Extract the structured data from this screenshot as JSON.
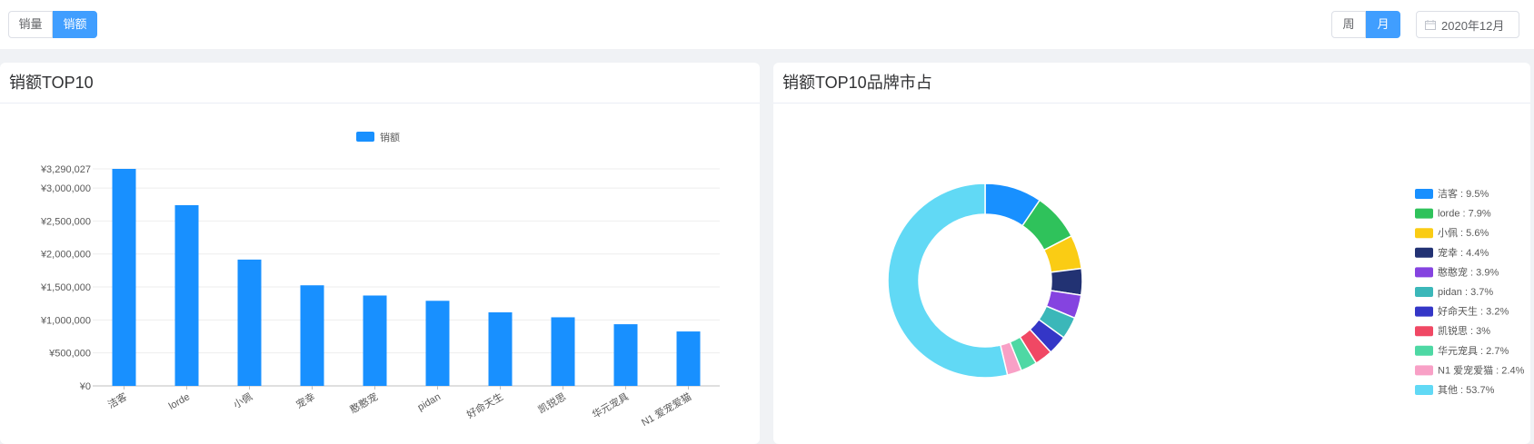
{
  "toolbar": {
    "metric_tabs": [
      {
        "label": "销量",
        "active": false
      },
      {
        "label": "销额",
        "active": true
      }
    ],
    "period_tabs": [
      {
        "label": "周",
        "active": false
      },
      {
        "label": "月",
        "active": true
      }
    ],
    "date_value": "2020年12月",
    "date_icon": "calendar-icon",
    "accent_color": "#409eff"
  },
  "bar_panel": {
    "title": "销额TOP10"
  },
  "pie_panel": {
    "title": "销额TOP10品牌市占"
  },
  "chart_data": [
    {
      "type": "bar",
      "title": "",
      "legend": [
        "销额"
      ],
      "legend_position": "top",
      "color": "#1890ff",
      "categories": [
        "洁客",
        "lorde",
        "小佩",
        "宠幸",
        "憨憨宠",
        "pidan",
        "好命天生",
        "凯锐思",
        "华元宠具",
        "N1 爱宠爱猫"
      ],
      "values": [
        3290027,
        2740000,
        1915000,
        1525000,
        1370000,
        1290000,
        1115000,
        1040000,
        935000,
        825000
      ],
      "y_ticks": [
        "¥0",
        "¥500,000",
        "¥1,000,000",
        "¥1,500,000",
        "¥2,000,000",
        "¥2,500,000",
        "¥3,000,000",
        "¥3,290,027"
      ],
      "y_tick_values": [
        0,
        500000,
        1000000,
        1500000,
        2000000,
        2500000,
        3000000,
        3290027
      ],
      "ylim": [
        0,
        3290027
      ],
      "grid": true
    },
    {
      "type": "pie",
      "donut": true,
      "title": "",
      "legend_position": "right",
      "slices": [
        {
          "label": "洁客",
          "value": 9.5,
          "legend_text": "洁客 : 9.5%",
          "color": "#1890ff"
        },
        {
          "label": "lorde",
          "value": 7.9,
          "legend_text": "lorde : 7.9%",
          "color": "#2fc25b"
        },
        {
          "label": "小佩",
          "value": 5.6,
          "legend_text": "小佩 : 5.6%",
          "color": "#facc14"
        },
        {
          "label": "宠幸",
          "value": 4.4,
          "legend_text": "宠幸 : 4.4%",
          "color": "#223273"
        },
        {
          "label": "憨憨宠",
          "value": 3.9,
          "legend_text": "憨憨宠 : 3.9%",
          "color": "#8543e0"
        },
        {
          "label": "pidan",
          "value": 3.7,
          "legend_text": "pidan : 3.7%",
          "color": "#3bb7b9"
        },
        {
          "label": "好命天生",
          "value": 3.2,
          "legend_text": "好命天生 : 3.2%",
          "color": "#3436c7"
        },
        {
          "label": "凯锐思",
          "value": 3.0,
          "legend_text": "凯锐思 : 3%",
          "color": "#f04864"
        },
        {
          "label": "华元宠具",
          "value": 2.7,
          "legend_text": "华元宠具 : 2.7%",
          "color": "#4ed8a4"
        },
        {
          "label": "N1 爱宠爱猫",
          "value": 2.4,
          "legend_text": "N1 爱宠爱猫 : 2.4%",
          "color": "#f8a0c6"
        },
        {
          "label": "其他",
          "value": 53.7,
          "legend_text": "其他 : 53.7%",
          "color": "#61d9f5"
        }
      ]
    }
  ]
}
